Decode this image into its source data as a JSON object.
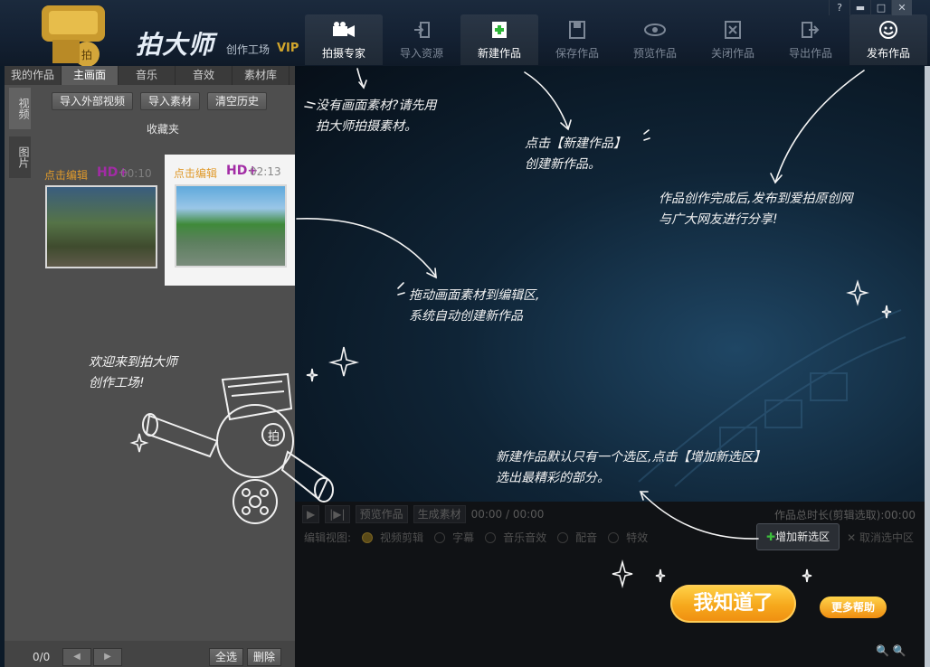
{
  "app": {
    "brand": "拍大师",
    "brand_sub": "创作工场",
    "vip": "VIP"
  },
  "toolbar": [
    {
      "label": "拍摄专家",
      "icon": "camera-icon",
      "active": true
    },
    {
      "label": "导入资源",
      "icon": "import-icon",
      "active": false
    },
    {
      "label": "新建作品",
      "icon": "new-icon",
      "active": true
    },
    {
      "label": "保存作品",
      "icon": "save-icon",
      "active": false
    },
    {
      "label": "预览作品",
      "icon": "eye-icon",
      "active": false
    },
    {
      "label": "关闭作品",
      "icon": "close-doc-icon",
      "active": false
    },
    {
      "label": "导出作品",
      "icon": "export-icon",
      "active": false
    },
    {
      "label": "发布作品",
      "icon": "smile-icon",
      "active": true
    }
  ],
  "window_controls": {
    "help": "?",
    "minimize": "▬",
    "restore": "□",
    "close": "✕"
  },
  "left_tabs": [
    "我的作品",
    "主画面",
    "音乐",
    "音效",
    "素材库"
  ],
  "left_side_tabs": [
    "视频",
    "图片"
  ],
  "left_buttons": [
    "导入外部视频",
    "导入素材",
    "清空历史"
  ],
  "favorites_label": "收藏夹",
  "clips": [
    {
      "edit_label": "点击编辑",
      "hd": "HD+",
      "duration": "00:10"
    },
    {
      "edit_label": "点击编辑",
      "hd": "HD+",
      "duration": "02:13"
    }
  ],
  "left_bottom": {
    "page": "0/0",
    "prev": "◀",
    "next": "▶",
    "select_all": "全选",
    "delete": "删除"
  },
  "controls": {
    "play": "▶",
    "step": "|▶|",
    "preview": "预览作品",
    "generate": "生成素材",
    "time": "00:00 / 00:00",
    "total": "作品总时长(剪辑选取):00:00",
    "edit_view": "编辑视图:",
    "views": [
      "视频剪辑",
      "字幕",
      "音乐音效",
      "配音",
      "特效"
    ],
    "add_selection": "增加新选区",
    "cancel_selection": "取消选中区"
  },
  "notes": {
    "no_material": [
      "没有画面素材?请先用",
      "拍大师拍摄素材。"
    ],
    "create": [
      "点击【新建作品】",
      "创建新作品。"
    ],
    "publish": [
      "作品创作完成后,发布到爱拍原创网",
      "与广大网友进行分享!"
    ],
    "drag": [
      "拖动画面素材到编辑区,",
      "系统自动创建新作品"
    ],
    "welcome": [
      "欢迎来到拍大师",
      "创作工场!"
    ],
    "selection": [
      "新建作品默认只有一个选区,点击【增加新选区】",
      "选出最精彩的部分。"
    ]
  },
  "got_it": "我知道了",
  "more_help": "更多帮助",
  "colors": {
    "accent": "#f6a81c",
    "header": "#142133",
    "panel": "#4e4e4e"
  }
}
